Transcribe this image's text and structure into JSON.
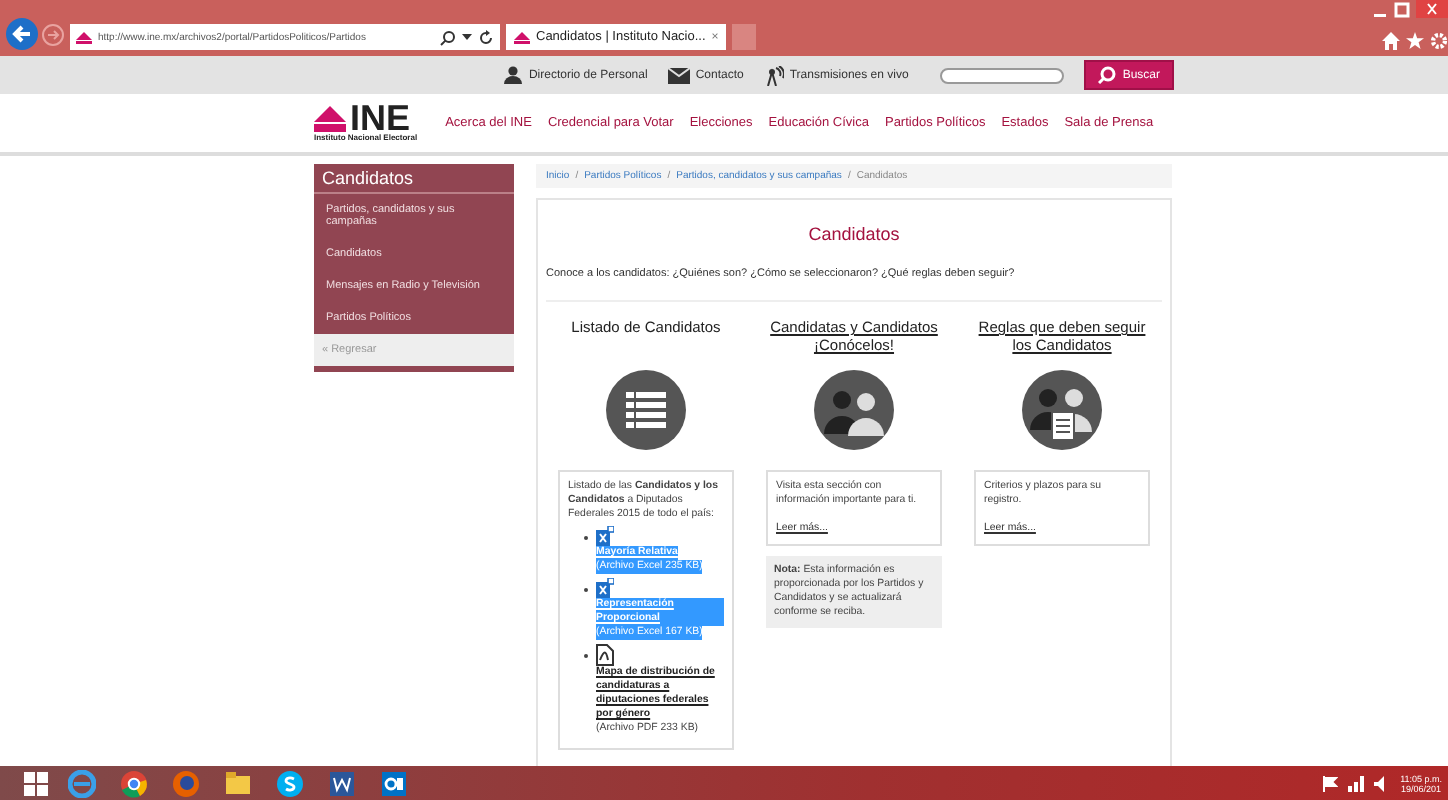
{
  "browser": {
    "url": "http://www.ine.mx/archivos2/portal/PartidosPoliticos/Partidos",
    "tab_title": "Candidatos | Instituto Nacio...",
    "tab_close": "×"
  },
  "topbar": {
    "links": [
      {
        "kind": "person",
        "label": "Directorio de Personal"
      },
      {
        "kind": "mail",
        "label": "Contacto"
      },
      {
        "kind": "antenna",
        "label": "Transmisiones en vivo"
      }
    ],
    "search_button": "Buscar"
  },
  "header": {
    "logo": "INE",
    "logo_subtitle": "Instituto Nacional Electoral",
    "nav": [
      "Acerca del INE",
      "Credencial para Votar",
      "Elecciones",
      "Educación Cívica",
      "Partidos Políticos",
      "Estados",
      "Sala de Prensa"
    ]
  },
  "sidebar": {
    "title": "Candidatos",
    "items": [
      "Partidos, candidatos y sus campañas",
      "Candidatos",
      "Mensajes en Radio y Televisión",
      "Partidos Políticos"
    ],
    "back": "« Regresar"
  },
  "breadcrumb": [
    {
      "label": "Inicio",
      "current": false
    },
    {
      "separator": "/",
      "label": "Partidos Políticos",
      "current": false
    },
    {
      "separator": "/",
      "label": "Partidos, candidatos y sus campañas",
      "current": false
    },
    {
      "separator": "/",
      "label": "Candidatos",
      "current": true
    }
  ],
  "content": {
    "title": "Candidatos",
    "intro": "Conoce a los candidatos: ¿Quiénes son? ¿Cómo se seleccionaron? ¿Qué reglas deben seguir?",
    "columns": [
      {
        "heading": "Listado de Candidatos",
        "underlined": false,
        "kind": "list",
        "text": "Listado de las **Candidatos y los Candidatos** a Diputados Federales 2015 de todo el país:",
        "files": [
          {
            "kind": "excel",
            "link": "Mayoría Relativa",
            "info": "(Archivo Excel 235 KB)",
            "selected": true
          },
          {
            "kind": "excel",
            "link": "Representación Proporcional",
            "info": "(Archivo Excel 167 KB)",
            "selected": true
          },
          {
            "kind": "pdf",
            "link": "Mapa de distribución de candidaturas a diputaciones federales por género",
            "info": "(Archivo PDF 233 KB)",
            "selected": false
          }
        ]
      },
      {
        "heading": "Candidatas y Candidatos ¡Conócelos!",
        "underlined": true,
        "kind": "people",
        "text": "Visita esta sección con información importante para ti.",
        "more": "Leer más...",
        "note": "**Nota:** Esta información es proporcionada por los Partidos y Candidatos y se actualizará conforme se reciba."
      },
      {
        "heading": "Reglas que deben seguir los Candidatos",
        "underlined": true,
        "kind": "people-doc",
        "text": "Criterios y plazos para su registro.",
        "more": "Leer más..."
      }
    ]
  },
  "taskbar": {
    "time": "11:05 p.m.",
    "date": "19/06/201"
  }
}
